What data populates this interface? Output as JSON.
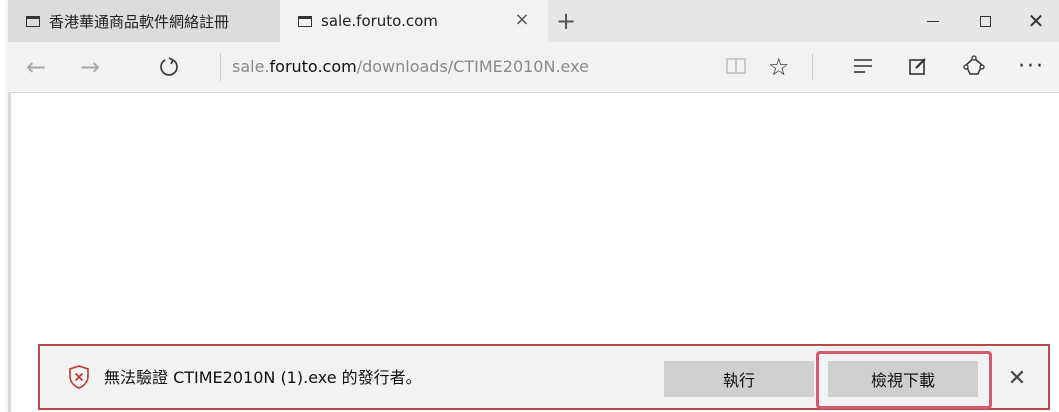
{
  "tabs": [
    {
      "title": "香港華通商品軟件網絡註冊",
      "active": false
    },
    {
      "title": "sale.foruto.com",
      "active": true
    }
  ],
  "tab_close_glyph": "×",
  "new_tab_glyph": "+",
  "window": {
    "close_glyph": "✕"
  },
  "nav": {
    "back_glyph": "←",
    "forward_glyph": "→",
    "refresh_glyph": "↻",
    "address": {
      "prefix": "sale.",
      "host": "foruto.com",
      "path": "/downloads/CTIME2010N.exe"
    },
    "favorite_glyph": "☆",
    "more_glyph": "···"
  },
  "download_bar": {
    "message": "無法驗證 CTIME2010N (1).exe 的發行者。",
    "run_label": "執行",
    "view_label": "檢視下載",
    "close_glyph": "✕",
    "border_color": "#b84a4a",
    "highlight_color": "#d25a6a"
  },
  "icons": [
    "tab-page-icon",
    "back-arrow-icon",
    "forward-arrow-icon",
    "refresh-icon",
    "reading-view-icon",
    "star-icon",
    "hub-icon",
    "web-note-icon",
    "share-icon",
    "more-icon",
    "shield-warning-icon",
    "close-icon"
  ]
}
